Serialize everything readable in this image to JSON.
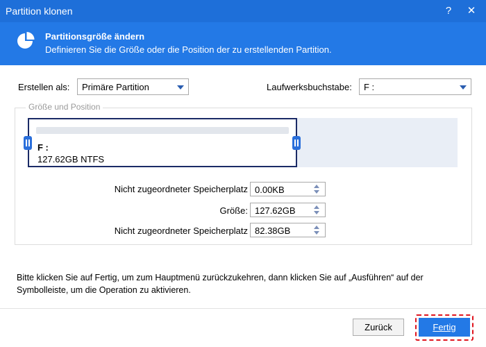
{
  "window": {
    "title": "Partition klonen",
    "help": "?",
    "close": "✕"
  },
  "header": {
    "icon": "pie-chart-icon",
    "title": "Partitionsgröße ändern",
    "subtitle": "Definieren Sie die Größe oder die Position der zu erstellenden Partition."
  },
  "create_as": {
    "label": "Erstellen als:",
    "value": "Primäre Partition"
  },
  "drive_letter": {
    "label": "Laufwerksbuchstabe:",
    "value": "F :"
  },
  "group": {
    "title": "Größe und Position",
    "partition": {
      "letter": "F :",
      "info": "127.62GB NTFS"
    }
  },
  "fields": [
    {
      "label": "Nicht zugeordneter Speicherplatz",
      "value": "0.00KB"
    },
    {
      "label": "Größe:",
      "value": "127.62GB"
    },
    {
      "label": "Nicht zugeordneter Speicherplatz",
      "value": "82.38GB"
    }
  ],
  "instruction": "Bitte klicken Sie auf Fertig, um zum Hauptmenü zurückzukehren, dann klicken Sie auf „Ausführen“ auf der Symbolleiste, um die Operation zu aktivieren.",
  "buttons": {
    "back": "Zurück",
    "finish": "Fertig"
  },
  "colors": {
    "titlebar": "#1e6fd9",
    "header": "#2379e6",
    "partition_border": "#1a2a66",
    "highlight": "#e0141e"
  }
}
